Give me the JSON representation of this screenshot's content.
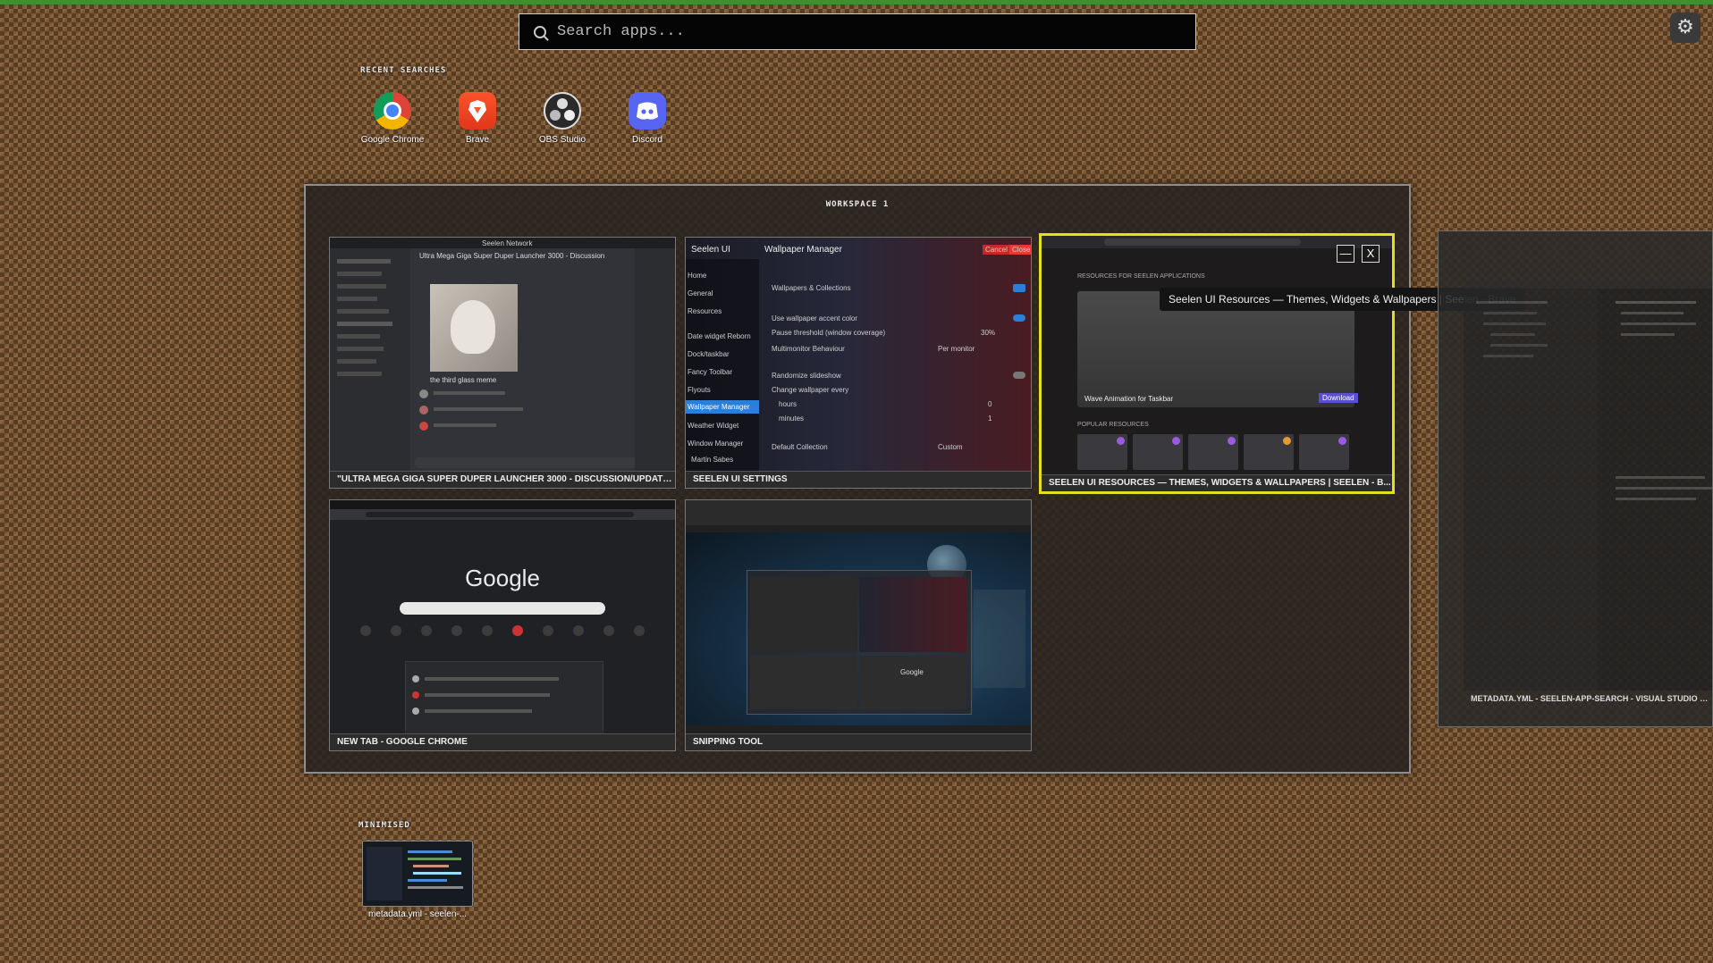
{
  "search": {
    "placeholder": "Search apps..."
  },
  "settings": {
    "icon": "gear-icon"
  },
  "recent": {
    "label": "RECENT SEARCHES",
    "apps": [
      {
        "label": "Google Chrome",
        "icon": "chrome-icon"
      },
      {
        "label": "Brave",
        "icon": "brave-icon"
      },
      {
        "label": "OBS Studio",
        "icon": "obs-icon"
      },
      {
        "label": "Discord",
        "icon": "discord-icon"
      }
    ]
  },
  "workspace": {
    "title": "WORKSPACE 1",
    "windows": [
      {
        "caption": "\"ULTRA MEGA GIGA SUPER DUPER LAUNCHER 3000 - DISCUSSION/UPDATE...",
        "preview": {
          "headline": "Seelen Network",
          "reply": "Ultra Mega Giga Super Duper Launcher 3000 - Discussion",
          "image_caption": "the third glass meme"
        }
      },
      {
        "caption": "SEELEN UI SETTINGS",
        "preview": {
          "app": "Seelen UI",
          "page": "Wallpaper Manager",
          "buttons": [
            "Cancel",
            "Close"
          ],
          "nav": [
            "Home",
            "General",
            "Resources",
            "Date widget Reborn",
            "Dock/taskbar",
            "Fancy Toolbar",
            "Flyouts",
            "Wallpaper Manager",
            "Weather Widget",
            "Window Manager"
          ],
          "user": "Martin Sabes",
          "settings": [
            {
              "label": "Wallpapers & Collections",
              "value": ""
            },
            {
              "label": "Use wallpaper accent color",
              "value": ""
            },
            {
              "label": "Pause threshold (window coverage)",
              "value": "30%"
            },
            {
              "label": "Multimonitor Behaviour",
              "value": "Per monitor"
            },
            {
              "label": "Randomize slideshow",
              "value": ""
            },
            {
              "label": "Change wallpaper every",
              "value": ""
            },
            {
              "label": "hours",
              "value": "0"
            },
            {
              "label": "minutes",
              "value": "1"
            },
            {
              "label": "Default Collection",
              "value": "Custom"
            }
          ]
        }
      },
      {
        "caption": "SEELEN UI RESOURCES — THEMES, WIDGETS & WALLPAPERS | SEELEN - B...",
        "selected": true,
        "tooltip": "Seelen UI Resources — Themes, Widgets & Wallpapers | Seelen - Brave",
        "minimize_icon": "minimize-icon",
        "close_icon": "close-icon",
        "preview": {
          "heading": "RESOURCES FOR SEELEN APPLICATIONS",
          "banner": "Wave Animation for Taskbar",
          "banner_button": "Download",
          "popular": "POPULAR RESOURCES"
        }
      },
      {
        "caption": "NEW TAB - GOOGLE CHROME",
        "preview": {
          "logo": "Google"
        }
      },
      {
        "caption": "SNIPPING TOOL",
        "preview": {
          "logo": "Google"
        }
      }
    ]
  },
  "offscreen_window": {
    "caption": "METADATA.YML - SEELEN-APP-SEARCH - VISUAL STUDIO CODE"
  },
  "minimised": {
    "label": "MINIMISED",
    "items": [
      {
        "caption": "metadata.yml - seelen-..."
      }
    ]
  },
  "colors": {
    "accent_selected": "#e6df1e",
    "top_bar": "#3f8f2e"
  }
}
